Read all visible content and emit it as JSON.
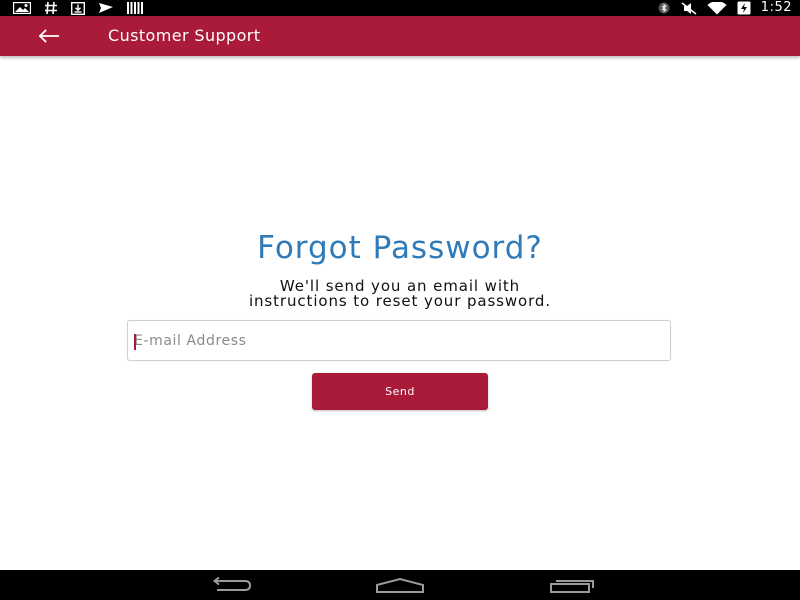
{
  "status_bar": {
    "time": "1:52",
    "left_icons": [
      "image-notification-icon",
      "hashtag-notification-icon",
      "download-notification-icon",
      "send-notification-icon",
      "barcode-notification-icon"
    ],
    "right_icons": [
      "bluetooth-icon",
      "mute-icon",
      "wifi-icon",
      "battery-charging-icon"
    ]
  },
  "app_bar": {
    "title": "Customer Support",
    "back_icon": "arrow-left-icon",
    "color": "#a91b39"
  },
  "main": {
    "title": "Forgot Password?",
    "description_line1": "We'll send you an email with",
    "description_line2": "instructions to reset your password.",
    "email_placeholder": "E-mail Address",
    "email_value": "",
    "send_label": "Send"
  },
  "colors": {
    "accent": "#a91b39",
    "title_blue": "#2f7ab8"
  },
  "nav_bar": {
    "buttons": [
      "back-nav-icon",
      "home-nav-icon",
      "recents-nav-icon"
    ]
  }
}
